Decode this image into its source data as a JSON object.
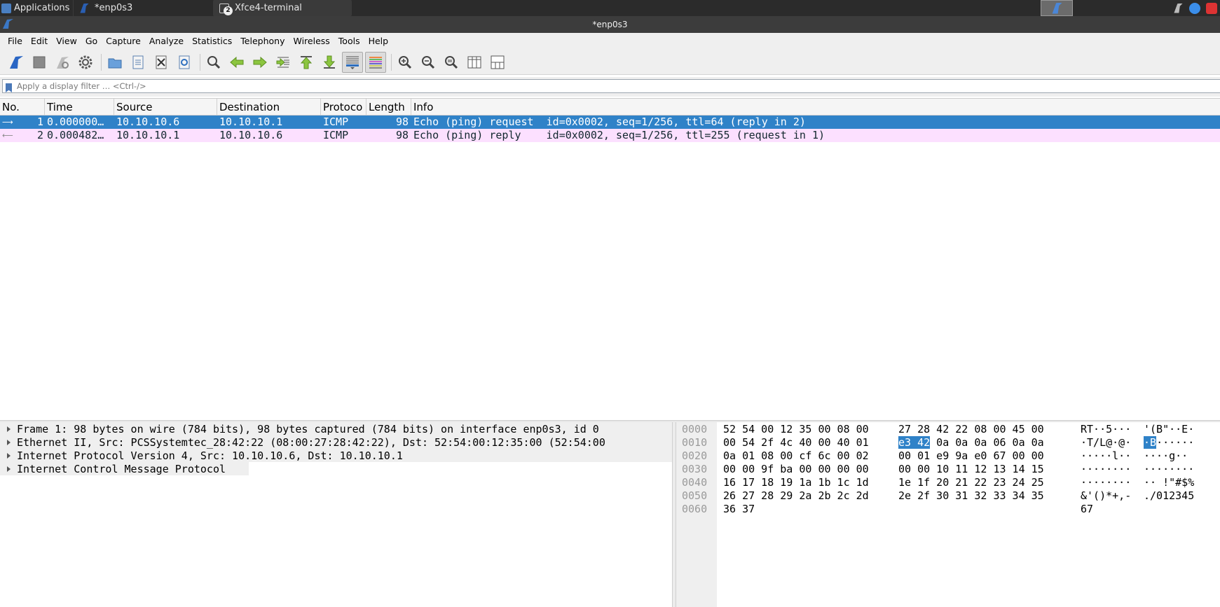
{
  "taskbar": {
    "apps_label": "Applications",
    "task1": "*enp0s3",
    "task2": "Xfce4-terminal",
    "task2_badge": "2"
  },
  "window": {
    "title": "*enp0s3"
  },
  "menu": [
    "File",
    "Edit",
    "View",
    "Go",
    "Capture",
    "Analyze",
    "Statistics",
    "Telephony",
    "Wireless",
    "Tools",
    "Help"
  ],
  "toolbar": {
    "icons": [
      "shark-start-icon",
      "stop-icon",
      "restart-icon",
      "options-gear-icon",
      "open-file-icon",
      "save-file-icon",
      "close-file-icon",
      "reload-icon",
      "find-icon",
      "back-arrow-icon",
      "forward-arrow-icon",
      "goto-packet-icon",
      "first-packet-icon",
      "last-packet-icon",
      "autoscroll-icon",
      "colorize-icon",
      "zoom-in-icon",
      "zoom-out-icon",
      "zoom-normal-icon",
      "resize-columns-icon",
      "layout-icon"
    ]
  },
  "filter": {
    "placeholder": "Apply a display filter … <Ctrl-/>"
  },
  "packet_list": {
    "columns": [
      "No.",
      "Time",
      "Source",
      "Destination",
      "Protoco",
      "Length",
      "Info"
    ],
    "rows": [
      {
        "no": "1",
        "time": "0.000000…",
        "src": "10.10.10.6",
        "dst": "10.10.10.1",
        "proto": "ICMP",
        "len": "98",
        "info": "Echo (ping) request  id=0x0002, seq=1/256, ttl=64 (reply in 2)"
      },
      {
        "no": "2",
        "time": "0.000482…",
        "src": "10.10.10.1",
        "dst": "10.10.10.6",
        "proto": "ICMP",
        "len": "98",
        "info": "Echo (ping) reply    id=0x0002, seq=1/256, ttl=255 (request in 1)"
      }
    ]
  },
  "details": [
    "Frame 1: 98 bytes on wire (784 bits), 98 bytes captured (784 bits) on interface enp0s3, id 0",
    "Ethernet II, Src: PCSSystemtec_28:42:22 (08:00:27:28:42:22), Dst: 52:54:00:12:35:00 (52:54:00",
    "Internet Protocol Version 4, Src: 10.10.10.6, Dst: 10.10.10.1",
    "Internet Control Message Protocol"
  ],
  "bytes": {
    "offsets": [
      "0000",
      "0010",
      "0020",
      "0030",
      "0040",
      "0050",
      "0060"
    ],
    "hex1": [
      "52 54 00 12 35 00 08 00",
      "00 54 2f 4c 40 00 40 01",
      "0a 01 08 00 cf 6c 00 02",
      "00 00 9f ba 00 00 00 00",
      "16 17 18 19 1a 1b 1c 1d",
      "26 27 28 29 2a 2b 2c 2d",
      "36 37"
    ],
    "hex2_pre": [
      "27 28 42 22 08 00 45 00",
      "",
      "00 01 e9 9a e0 67 00 00",
      "00 00 10 11 12 13 14 15",
      "1e 1f 20 21 22 23 24 25",
      "2e 2f 30 31 32 33 34 35",
      ""
    ],
    "hex2_hl": "e3 42",
    "hex2_post": " 0a 0a 0a 06 0a 0a",
    "ascii1": [
      "RT··5···",
      "·T/L@·@·",
      "········",
      "········",
      "········",
      "&'()*+,-",
      "67"
    ],
    "ascii2_pre": [
      "'(B\"··E·",
      "",
      "····g··",
      "········",
      "·· !\"#$%",
      "./012345",
      ""
    ],
    "ascii2_hl": "·B",
    "ascii2_post": "······",
    "ascii1_row2": "·····l··"
  }
}
